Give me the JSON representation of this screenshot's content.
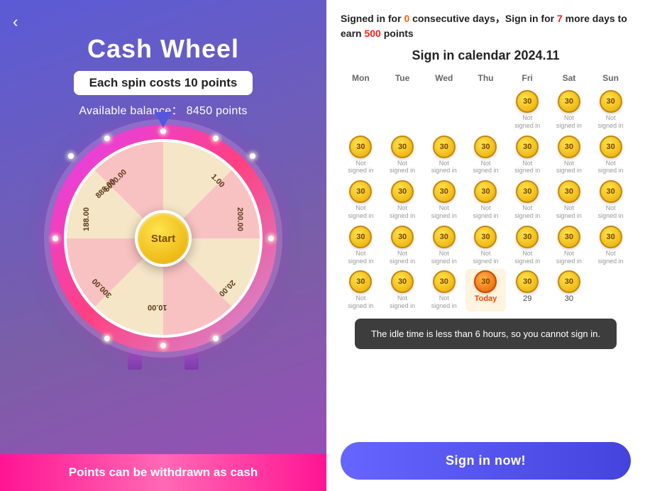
{
  "left": {
    "back_label": "‹",
    "title": "Cash Wheel",
    "spin_cost": "Each spin costs 10 points",
    "balance_label": "Available balance：",
    "balance_value": "8450 points",
    "start_button": "Start",
    "segments": [
      "5000.00",
      "1.00",
      "200.00",
      "20.00",
      "10.00",
      "300.00",
      "188.00",
      "888.00"
    ],
    "bottom_banner": "Points can be withdrawn as cash"
  },
  "right": {
    "streak_text_part1": "Signed in for ",
    "streak_days": "0",
    "streak_text_part2": " consecutive days，Sign in for ",
    "streak_needed": "7",
    "streak_text_part3": " more days to earn ",
    "streak_points": "500",
    "streak_text_part4": " points",
    "calendar_title": "Sign in calendar 2024.11",
    "headers": [
      "Mon",
      "Tue",
      "Wed",
      "Thu",
      "Fri",
      "Sat",
      "Sun"
    ],
    "tooltip": "The idle time is less than 6 hours, so you cannot sign in.",
    "sign_in_btn": "Sign in now!",
    "coin_value": "30",
    "today_label": "Today",
    "day_labels": [
      "29",
      "30"
    ]
  }
}
